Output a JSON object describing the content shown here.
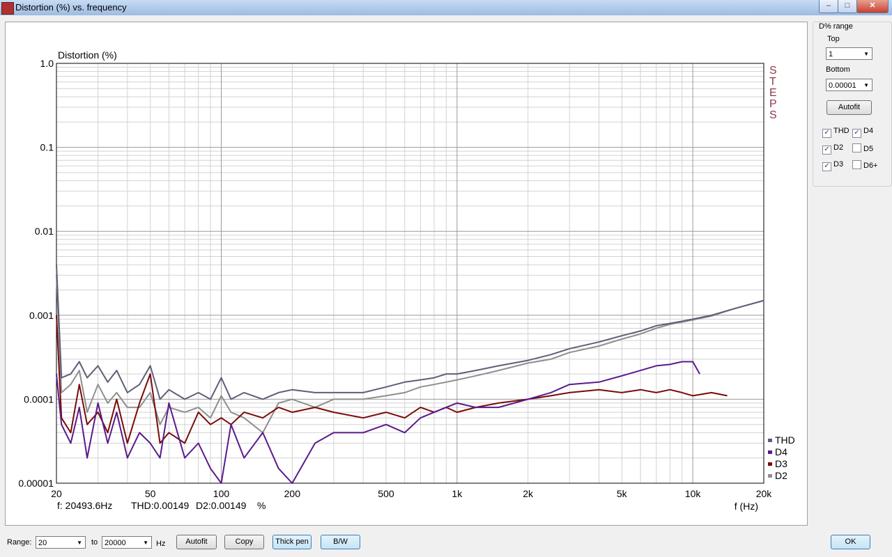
{
  "window": {
    "title": "Distortion (%) vs. frequency"
  },
  "chart_data": {
    "type": "line",
    "title": "Distortion (%)",
    "xlabel": "f (Hz)",
    "x_scale": "log",
    "y_scale": "log",
    "xlim": [
      20,
      20000
    ],
    "ylim": [
      1e-05,
      1.0
    ],
    "x_ticks": [
      "20",
      "50",
      "100",
      "200",
      "500",
      "1k",
      "2k",
      "5k",
      "10k",
      "20k"
    ],
    "y_ticks": [
      "1.0",
      "0.1",
      "0.01",
      "0.001",
      "0.0001",
      "0.00001"
    ],
    "grid": true,
    "watermark": "STEPS",
    "legend_position": "bottom-right",
    "readout": {
      "freq": "f: 20493.6Hz",
      "thd": "THD:0.00149",
      "d2": "D2:0.00149",
      "unit": "%"
    },
    "series": [
      {
        "name": "THD",
        "color": "#5e5e78",
        "x": [
          20,
          21,
          23,
          25,
          27,
          30,
          33,
          36,
          40,
          45,
          50,
          55,
          60,
          70,
          80,
          90,
          100,
          110,
          125,
          150,
          175,
          200,
          250,
          300,
          400,
          500,
          600,
          700,
          800,
          900,
          1000,
          1200,
          1500,
          2000,
          2500,
          3000,
          4000,
          5000,
          6000,
          7000,
          8000,
          9000,
          10000,
          12000,
          15000,
          20000
        ],
        "y": [
          0.004,
          0.00018,
          0.0002,
          0.00028,
          0.00018,
          0.00025,
          0.00016,
          0.00022,
          0.00012,
          0.00015,
          0.00025,
          0.0001,
          0.00013,
          0.0001,
          0.00012,
          0.0001,
          0.00018,
          0.0001,
          0.00012,
          0.0001,
          0.00012,
          0.00013,
          0.00012,
          0.00012,
          0.00012,
          0.00014,
          0.00016,
          0.00017,
          0.00018,
          0.0002,
          0.0002,
          0.00022,
          0.00025,
          0.00029,
          0.00034,
          0.0004,
          0.00048,
          0.00057,
          0.00065,
          0.00075,
          0.0008,
          0.00085,
          0.0009,
          0.001,
          0.0012,
          0.0015
        ]
      },
      {
        "name": "D4",
        "color": "#5a1a8a",
        "x": [
          20,
          21,
          23,
          25,
          27,
          30,
          33,
          36,
          40,
          45,
          50,
          55,
          60,
          70,
          80,
          90,
          100,
          110,
          125,
          150,
          175,
          200,
          250,
          300,
          400,
          500,
          600,
          700,
          800,
          900,
          1000,
          1200,
          1500,
          2000,
          2500,
          3000,
          4000,
          5000,
          6000,
          7000,
          8000,
          9000,
          10000,
          10700
        ],
        "y": [
          0.0002,
          5e-05,
          3e-05,
          8e-05,
          2e-05,
          9e-05,
          3e-05,
          7e-05,
          2e-05,
          4e-05,
          3e-05,
          2e-05,
          9e-05,
          2e-05,
          3e-05,
          1.5e-05,
          1e-05,
          5e-05,
          2e-05,
          4e-05,
          1.5e-05,
          1e-05,
          3e-05,
          4e-05,
          4e-05,
          5e-05,
          4e-05,
          6e-05,
          7e-05,
          8e-05,
          9e-05,
          8e-05,
          8e-05,
          0.0001,
          0.00012,
          0.00015,
          0.00016,
          0.00019,
          0.00022,
          0.00025,
          0.00026,
          0.00028,
          0.00028,
          0.0002
        ]
      },
      {
        "name": "D3",
        "color": "#7a0a0a",
        "x": [
          20,
          21,
          23,
          25,
          27,
          30,
          33,
          36,
          40,
          45,
          50,
          55,
          60,
          70,
          80,
          90,
          100,
          110,
          125,
          150,
          175,
          200,
          250,
          300,
          400,
          500,
          600,
          700,
          800,
          900,
          1000,
          1200,
          1500,
          2000,
          2500,
          3000,
          4000,
          5000,
          6000,
          7000,
          8000,
          9000,
          10000,
          12000,
          14000
        ],
        "y": [
          0.001,
          6e-05,
          4e-05,
          0.00015,
          5e-05,
          7e-05,
          4e-05,
          0.0001,
          3e-05,
          9e-05,
          0.0002,
          3e-05,
          4e-05,
          3e-05,
          7e-05,
          5e-05,
          6e-05,
          5e-05,
          7e-05,
          6e-05,
          8e-05,
          7e-05,
          8e-05,
          7e-05,
          6e-05,
          7e-05,
          6e-05,
          8e-05,
          7e-05,
          8e-05,
          7e-05,
          8e-05,
          9e-05,
          0.0001,
          0.00011,
          0.00012,
          0.00013,
          0.00012,
          0.00013,
          0.00012,
          0.00013,
          0.00012,
          0.00011,
          0.00012,
          0.00011
        ]
      },
      {
        "name": "D2",
        "color": "#8e8e8e",
        "x": [
          20,
          21,
          23,
          25,
          27,
          30,
          33,
          36,
          40,
          45,
          50,
          55,
          60,
          70,
          80,
          90,
          100,
          110,
          125,
          150,
          175,
          200,
          250,
          300,
          400,
          500,
          600,
          700,
          800,
          900,
          1000,
          1200,
          1500,
          2000,
          2500,
          3000,
          4000,
          5000,
          6000,
          7000,
          8000,
          9000,
          10000,
          12000,
          15000,
          20000
        ],
        "y": [
          0.003,
          0.00012,
          0.00015,
          0.00022,
          7e-05,
          0.00015,
          9e-05,
          0.00012,
          8e-05,
          8e-05,
          0.00012,
          5e-05,
          8e-05,
          7e-05,
          8e-05,
          6e-05,
          0.00011,
          7e-05,
          6e-05,
          4e-05,
          9e-05,
          0.0001,
          8e-05,
          0.0001,
          0.0001,
          0.00011,
          0.00012,
          0.00014,
          0.00015,
          0.00016,
          0.00017,
          0.00019,
          0.00022,
          0.00027,
          0.0003,
          0.00036,
          0.00043,
          0.00052,
          0.0006,
          0.0007,
          0.00078,
          0.00083,
          0.00088,
          0.00098,
          0.0012,
          0.0015
        ]
      }
    ]
  },
  "side_panel": {
    "group_label": "D% range",
    "top_label": "Top",
    "top_value": "1",
    "bottom_label": "Bottom",
    "bottom_value": "0.00001",
    "autofit_label": "Autofit",
    "checkboxes": [
      {
        "label": "THD",
        "checked": true
      },
      {
        "label": "D4",
        "checked": true
      },
      {
        "label": "D2",
        "checked": true
      },
      {
        "label": "D5",
        "checked": false
      },
      {
        "label": "D3",
        "checked": true
      },
      {
        "label": "D6+",
        "checked": false
      }
    ]
  },
  "bottom_bar": {
    "range_label": "Range:",
    "range_from": "20",
    "to_label": "to",
    "range_to": "20000",
    "hz_label": "Hz",
    "autofit_label": "Autofit",
    "copy_label": "Copy",
    "thick_pen_label": "Thick pen",
    "bw_label": "B/W",
    "ok_label": "OK"
  }
}
